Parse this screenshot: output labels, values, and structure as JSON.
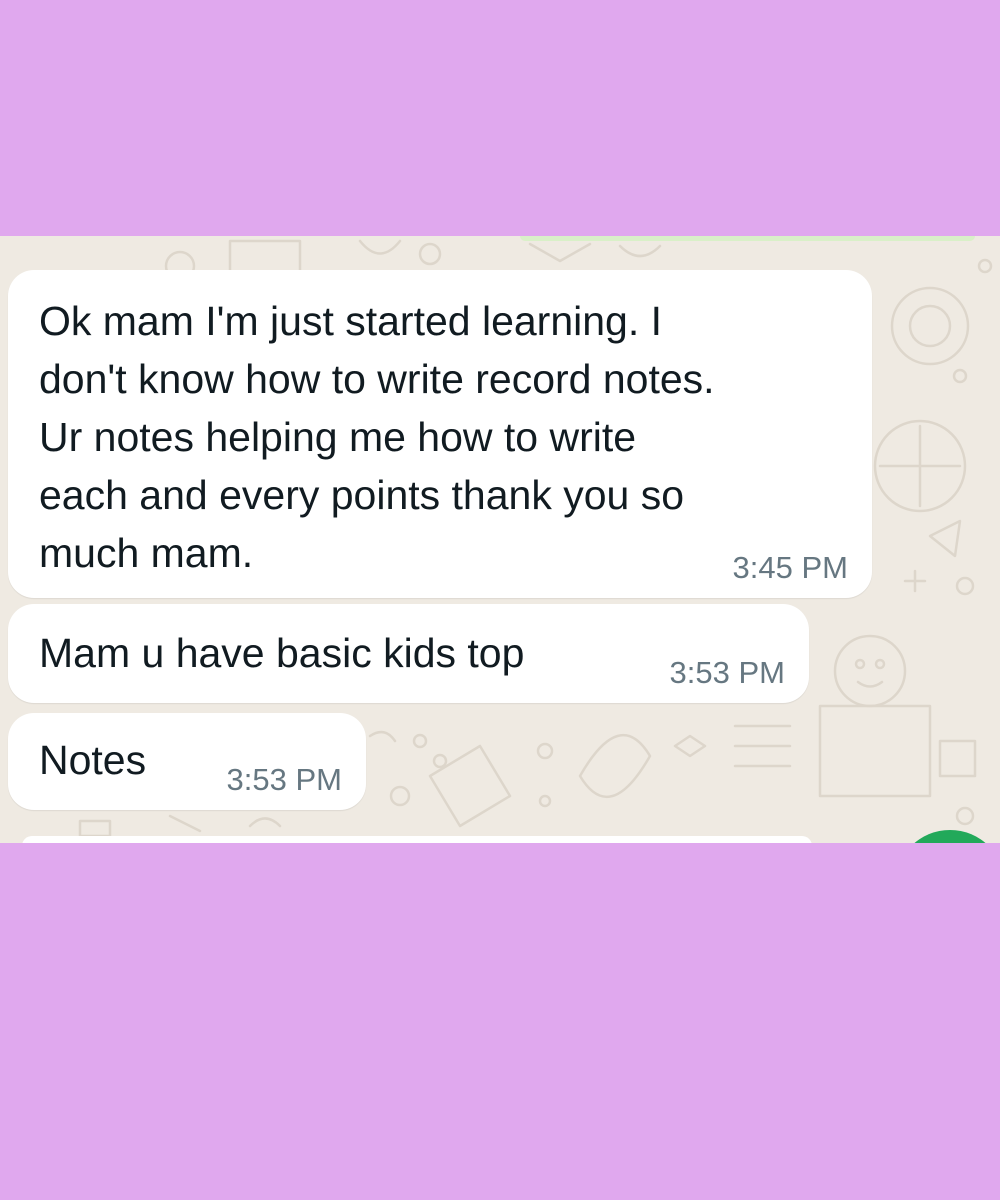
{
  "colors": {
    "frame_background": "#e0a8ee",
    "chat_background": "#efeae2",
    "bubble_incoming": "#ffffff",
    "timestamp": "#667781",
    "send_button": "#22a95a"
  },
  "messages": [
    {
      "text": "Ok mam I'm just started learning. I\ndon't know how to write record notes.\nUr notes helping me how to write\neach and every points thank you so\nmuch mam.",
      "time": "3:45 PM"
    },
    {
      "text": "Mam u have basic kids top",
      "time": "3:53 PM"
    },
    {
      "text": "Notes",
      "time": "3:53 PM"
    }
  ],
  "icons": {
    "send_button": "send-icon"
  }
}
